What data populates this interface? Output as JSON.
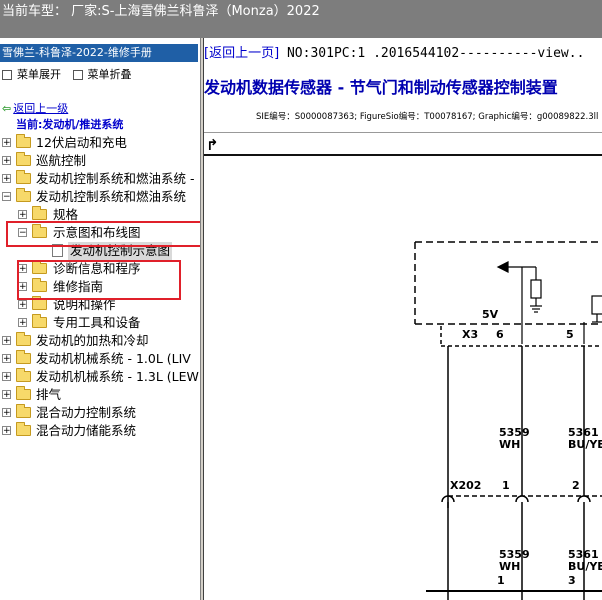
{
  "titlebar": {
    "text": "当前车型：  厂家:S-上海雪佛兰科鲁泽（Monza）2022"
  },
  "left": {
    "header": "雪佛兰-科鲁泽-2022-维修手册",
    "expand_label": "菜单展开",
    "collapse_label": "菜单折叠",
    "back_label": "返回上一级",
    "current_label": "当前:发动机/推进系统",
    "tree": [
      {
        "label": "12伏启动和充电"
      },
      {
        "label": "巡航控制"
      },
      {
        "label": "发动机控制系统和燃油系统 -"
      },
      {
        "label": "发动机控制系统和燃油系统"
      },
      {
        "label": "规格"
      },
      {
        "label": "示意图和布线图"
      },
      {
        "label": "发动机控制示意图"
      },
      {
        "label": "诊断信息和程序"
      },
      {
        "label": "维修指南"
      },
      {
        "label": "说明和操作"
      },
      {
        "label": "专用工具和设备"
      },
      {
        "label": "发动机的加热和冷却"
      },
      {
        "label": "发动机机械系统 - 1.0L (LIV"
      },
      {
        "label": "发动机机械系统 - 1.3L (LEW"
      },
      {
        "label": "排气"
      },
      {
        "label": "混合动力控制系统"
      },
      {
        "label": "混合动力储能系统"
      }
    ]
  },
  "right": {
    "back_link": "[返回上一页]",
    "doc_no": " NO:301PC:1 .2016544102----------view..",
    "title": "发动机数据传感器 - 节气门和制动传感器控制装置",
    "ids": "SIE编号：S0000087363;  FigureSio编号：T00078167;  Graphic编号：g00089822.3ll",
    "diagram": {
      "voltage": "5V",
      "connector_top": "X3",
      "pin_6": "6",
      "pin_5": "5",
      "wire_a_num": "5359",
      "wire_a_color": "WH",
      "wire_b_num": "5361",
      "wire_b_color": "BU/YE",
      "connector_mid": "X202",
      "pin_1": "1",
      "pin_2": "2",
      "wire_a_num2": "5359",
      "wire_a_color2": "WH",
      "wire_b_num2": "5361",
      "wire_b_color2": "BU/YE",
      "pin_b1": "1",
      "pin_b3": "3"
    }
  }
}
